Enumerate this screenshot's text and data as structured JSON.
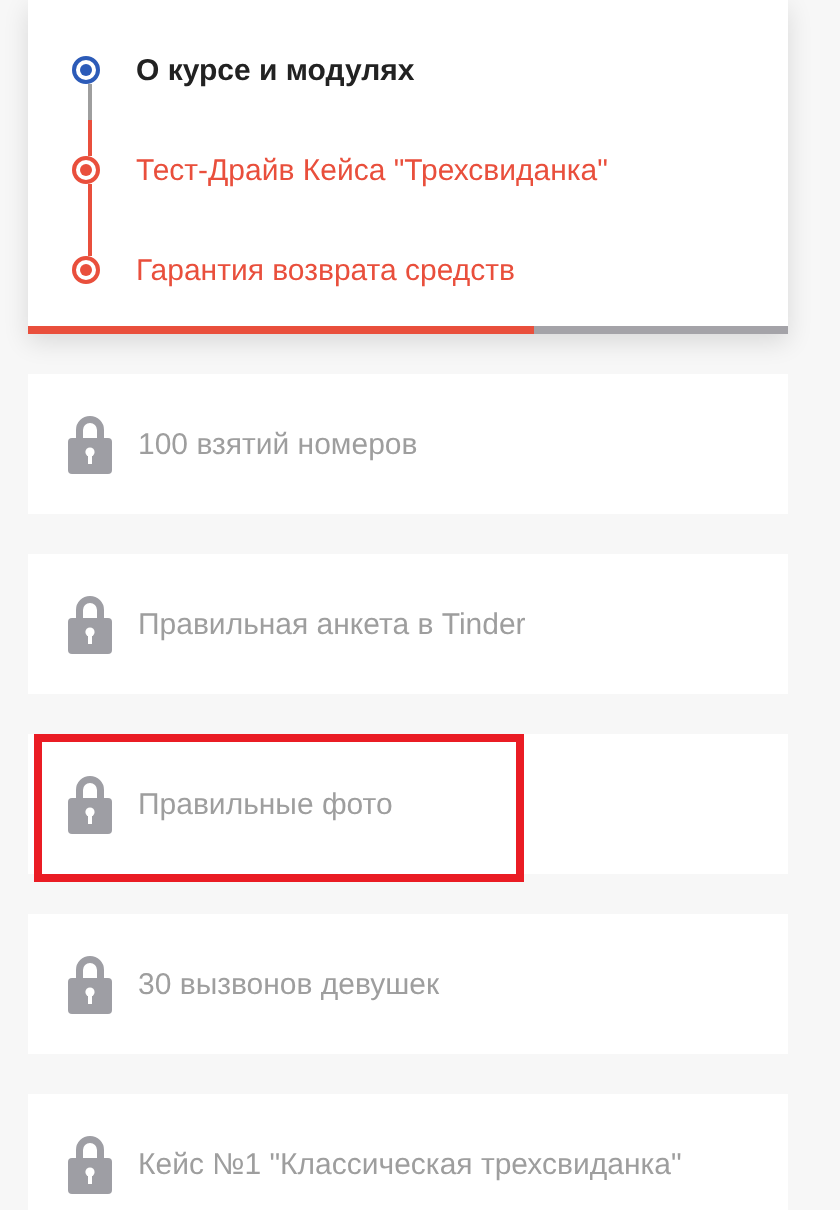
{
  "steps": [
    {
      "label": "О курсе и модулях",
      "selected": true
    },
    {
      "label": "Тест-Драйв Кейса \"Трехсвиданка\"",
      "selected": false
    },
    {
      "label": "Гарантия возврата средств",
      "selected": false
    }
  ],
  "progress": {
    "level": 0.667
  },
  "modules": [
    {
      "label": "100 взятий номеров",
      "locked": true,
      "highlighted": false
    },
    {
      "label": "Правильная анкета в Tinder",
      "locked": true,
      "highlighted": false
    },
    {
      "label": "Правильные фото",
      "locked": true,
      "highlighted": true
    },
    {
      "label": "30 вызвонов девушек",
      "locked": true,
      "highlighted": false
    },
    {
      "label": "Кейс №1 \"Классическая трехсвиданка\"",
      "locked": true,
      "highlighted": false
    }
  ]
}
